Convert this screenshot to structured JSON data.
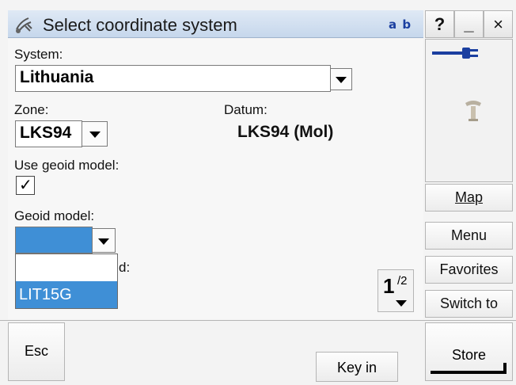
{
  "titlebar": {
    "title": "Select coordinate system",
    "input_mode": "a b",
    "help_label": "?",
    "minimize_label": "_",
    "close_label": "×",
    "app_icon": "satellite-icon"
  },
  "form": {
    "system_label": "System:",
    "system_value": "Lithuania",
    "zone_label": "Zone:",
    "zone_value": "LKS94",
    "datum_label": "Datum:",
    "datum_value": "LKS94 (Mol)",
    "geoid_use_label": "Use geoid model:",
    "geoid_use_checked": true,
    "geoid_use_mark": "✓",
    "geoid_model_label": "Geoid model:",
    "geoid_model_value": "",
    "hidden_label_fragment": "d:",
    "geoid_options": [
      "",
      "LIT15G"
    ],
    "geoid_selected_option": "LIT15G"
  },
  "page_indicator": {
    "current": "1",
    "total": "/2"
  },
  "side": {
    "status_icons": [
      "plug-icon",
      "receiver-icon"
    ],
    "map_label": "Map",
    "menu_label": "Menu",
    "favorites_label": "Favorites",
    "switch_label": "Switch to"
  },
  "bottom": {
    "esc_label": "Esc",
    "keyin_label": "Key in",
    "store_label": "Store"
  },
  "colors": {
    "title_bar": "#c6d7ec",
    "selection": "#3f8fd6",
    "plug": "#1b3fa0"
  }
}
